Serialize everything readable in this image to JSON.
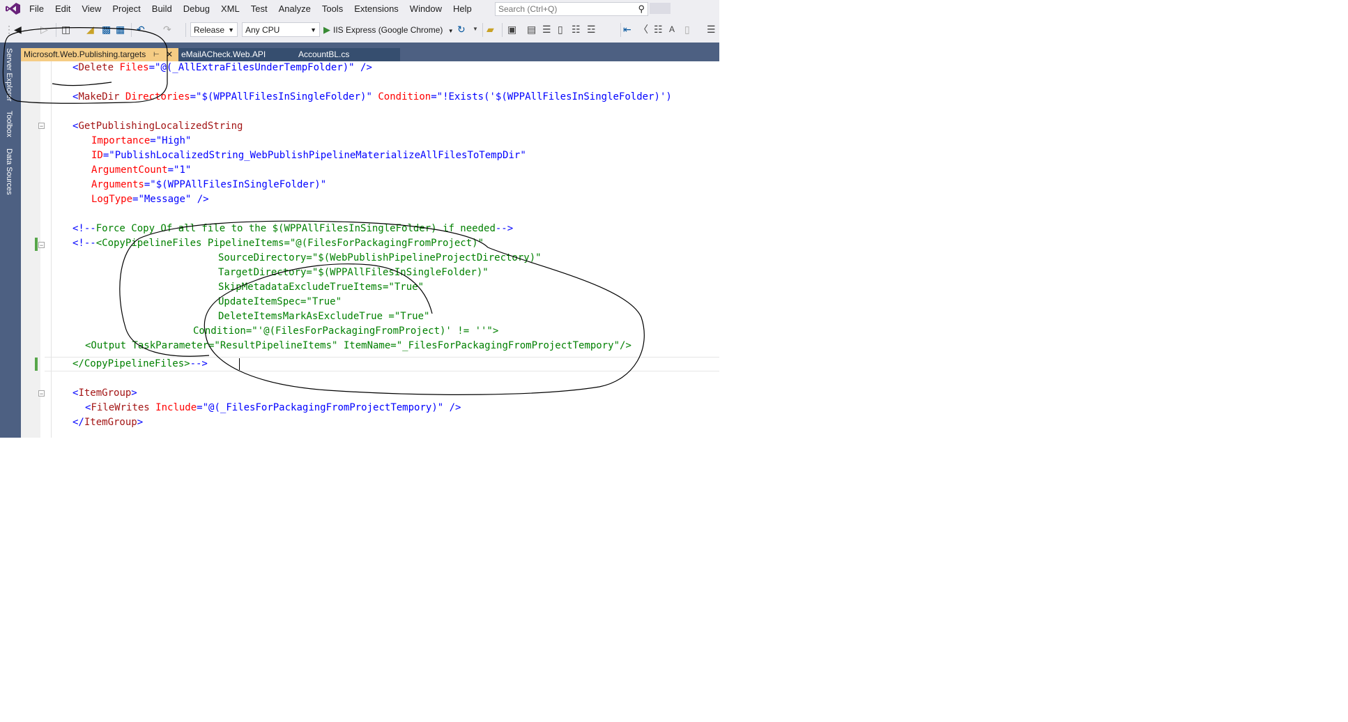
{
  "menubar": {
    "items": [
      "File",
      "Edit",
      "View",
      "Project",
      "Build",
      "Debug",
      "XML",
      "Test",
      "Analyze",
      "Tools",
      "Extensions",
      "Window",
      "Help"
    ],
    "search_placeholder": "Search (Ctrl+Q)"
  },
  "toolbar": {
    "configuration": "Release",
    "platform": "Any CPU",
    "run_target": "IIS Express (Google Chrome)"
  },
  "left_strip": {
    "tabs": [
      "Server Explorer",
      "Toolbox",
      "Data Sources"
    ]
  },
  "tabs": [
    {
      "label": "Microsoft.Web.Publishing.targets",
      "active": true
    },
    {
      "label": "eMailACheck.Web.API",
      "active": false
    },
    {
      "label": "AccountBL.cs",
      "active": false
    }
  ],
  "colors": {
    "chrome_bg": "#eeeef2",
    "strip_bg": "#4d6082",
    "active_tab": "#f5cc84",
    "xml_delimiter": "#0000ff",
    "xml_element": "#a31515",
    "xml_attribute": "#ff0000",
    "comment": "#008000",
    "change_marker": "#57a64a"
  },
  "code": {
    "l1": {
      "a": "<",
      "b": "Delete",
      "c": " Files",
      "d": "=\"",
      "e": "@(_AllExtraFilesUnderTempFolder)",
      "f": "\" />"
    },
    "l2": {
      "a": "<",
      "b": "MakeDir",
      "c": " Directories",
      "d": "=\"",
      "e": "$(WPPAllFilesInSingleFolder)",
      "f": "\"",
      "g": " Condition",
      "h": "=\"",
      "i": "!Exists('$(WPPAllFilesInSingleFolder)')"
    },
    "l3": {
      "a": "<",
      "b": "GetPublishingLocalizedString"
    },
    "l4": {
      "a": "Importance",
      "b": "=\"",
      "c": "High",
      "d": "\""
    },
    "l5": {
      "a": "ID",
      "b": "=\"",
      "c": "PublishLocalizedString_WebPublishPipelineMaterializeAllFilesToTempDir",
      "d": "\""
    },
    "l6": {
      "a": "ArgumentCount",
      "b": "=\"",
      "c": "1",
      "d": "\""
    },
    "l7": {
      "a": "Arguments",
      "b": "=\"",
      "c": "$(WPPAllFilesInSingleFolder)",
      "d": "\""
    },
    "l8": {
      "a": "LogType",
      "b": "=\"",
      "c": "Message",
      "d": "\" />"
    },
    "l9": {
      "a": "<!--",
      "b": "Force Copy Of all file to the $(WPPAllFilesInSingleFolder) if needed",
      "c": "-->"
    },
    "l10": {
      "a": "<!--",
      "b": "<CopyPipelineFiles PipelineItems=\"@(FilesForPackagingFromProject)\""
    },
    "l11": "SourceDirectory=\"$(WebPublishPipelineProjectDirectory)\"",
    "l12": "TargetDirectory=\"$(WPPAllFilesInSingleFolder)\"",
    "l13": "SkipMetadataExcludeTrueItems=\"True\"",
    "l14": "UpdateItemSpec=\"True\"",
    "l15": "DeleteItemsMarkAsExcludeTrue =\"True\"",
    "l16": "Condition=\"'@(FilesForPackagingFromProject)' != ''\">",
    "l17": "<Output TaskParameter=\"ResultPipelineItems\" ItemName=\"_FilesForPackagingFromProjectTempory\"/>",
    "l18": {
      "a": "</CopyPipelineFiles>",
      "b": "-->"
    },
    "l19": {
      "a": "<",
      "b": "ItemGroup",
      "c": ">"
    },
    "l20": {
      "a": "<",
      "b": "FileWrites",
      "c": " Include",
      "d": "=\"",
      "e": "@(_FilesForPackagingFromProjectTempory)",
      "f": "\" />"
    },
    "l21": {
      "a": "</",
      "b": "ItemGroup",
      "c": ">"
    }
  }
}
